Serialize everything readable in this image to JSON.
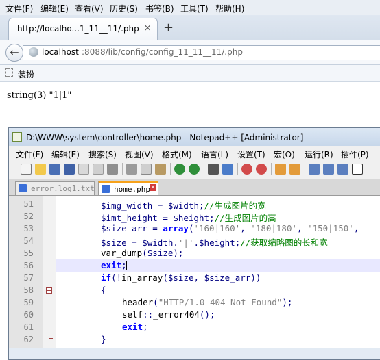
{
  "browser": {
    "menu": [
      "文件(F)",
      "编辑(E)",
      "查看(V)",
      "历史(S)",
      "书签(B)",
      "工具(T)",
      "帮助(H)"
    ],
    "tab_title": "http://localho...1_11__11/.php",
    "tab_close": "×",
    "new_tab": "+",
    "url_host": "localhost",
    "url_rest": ":8088/lib/config/config_11_11__11/.php",
    "back": "←",
    "bookmark_label": "装扮"
  },
  "page": {
    "output": "string(3) \"1|1\""
  },
  "notepad": {
    "title": "D:\\WWW\\system\\controller\\home.php - Notepad++ [Administrator]",
    "menu": [
      "文件(F)",
      "编辑(E)",
      "搜索(S)",
      "视图(V)",
      "格式(M)",
      "语言(L)",
      "设置(T)",
      "宏(O)",
      "运行(R)",
      "插件(P)"
    ],
    "tabs": [
      {
        "label": "error.log1.txt",
        "active": false
      },
      {
        "label": "home.php",
        "active": true
      }
    ],
    "line_numbers": [
      "51",
      "52",
      "53",
      "54",
      "55",
      "56",
      "57",
      "58",
      "59",
      "60",
      "61",
      "62"
    ],
    "code": {
      "l51": {
        "a": "$img_width",
        "b": " = ",
        "c": "$width",
        "d": ";",
        "e": "//生成图片的宽"
      },
      "l52": {
        "a": "$imt_height",
        "b": " = ",
        "c": "$height",
        "d": ";",
        "e": "//生成图片的高"
      },
      "l53": {
        "a": "$size_arr",
        "b": " = ",
        "c": "array",
        "d": "(",
        "e": "'160|160'",
        "f": ", ",
        "g": "'180|180'",
        "h": ", ",
        "i": "'150|150'",
        "j": ","
      },
      "l54": {
        "a": "$size",
        "b": " = ",
        "c": "$width",
        "d": ".",
        "e": "'|'",
        "f": ".",
        "g": "$height",
        "h": ";",
        "i": "//获取缩略图的长和宽"
      },
      "l55": {
        "a": "var_dump",
        "b": "(",
        "c": "$size",
        "d": ");"
      },
      "l56": {
        "a": "exit",
        "b": ";"
      },
      "l57": {
        "a": "if",
        "b": "(!",
        "c": "in_array",
        "d": "(",
        "e": "$size",
        "f": ", ",
        "g": "$size_arr",
        "h": "))"
      },
      "l58": {
        "a": "{"
      },
      "l59": {
        "a": "header",
        "b": "(",
        "c": "\"HTTP/1.0 404 Not Found\"",
        "d": ");"
      },
      "l60": {
        "a": "self",
        "b": "::",
        "c": "_error404",
        "d": "();"
      },
      "l61": {
        "a": "exit",
        "b": ";"
      },
      "l62": {
        "a": "}"
      }
    }
  },
  "colors": {
    "keyword": "#0000ff",
    "variable": "#000080",
    "string": "#808080",
    "comment": "#008000",
    "caret_line": "#e8e8ff",
    "active_tab_accent": "#f7a21b"
  }
}
